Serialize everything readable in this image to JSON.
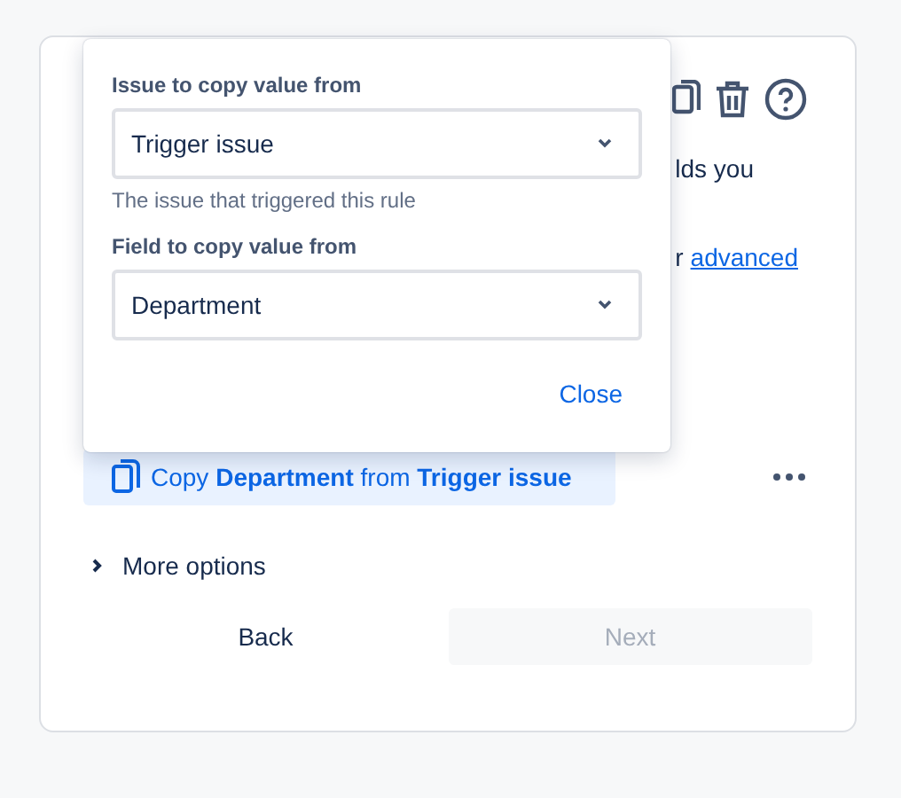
{
  "popup": {
    "fields": [
      {
        "label": "Issue to copy value from",
        "value": "Trigger issue",
        "helper": "The issue that triggered this rule"
      },
      {
        "label": "Field to copy value from",
        "value": "Department"
      }
    ],
    "close_button": "Close"
  },
  "background": {
    "description_fragment": "lds you",
    "link_prefix": "r",
    "link": "advanced"
  },
  "action": {
    "text": "Copy **Department** from **Trigger issue**"
  },
  "more_options": {
    "label": "More options",
    "expanded": false
  },
  "buttons": [
    {
      "label": "Back",
      "disabled": false
    },
    {
      "label": "Next",
      "disabled": true
    }
  ]
}
